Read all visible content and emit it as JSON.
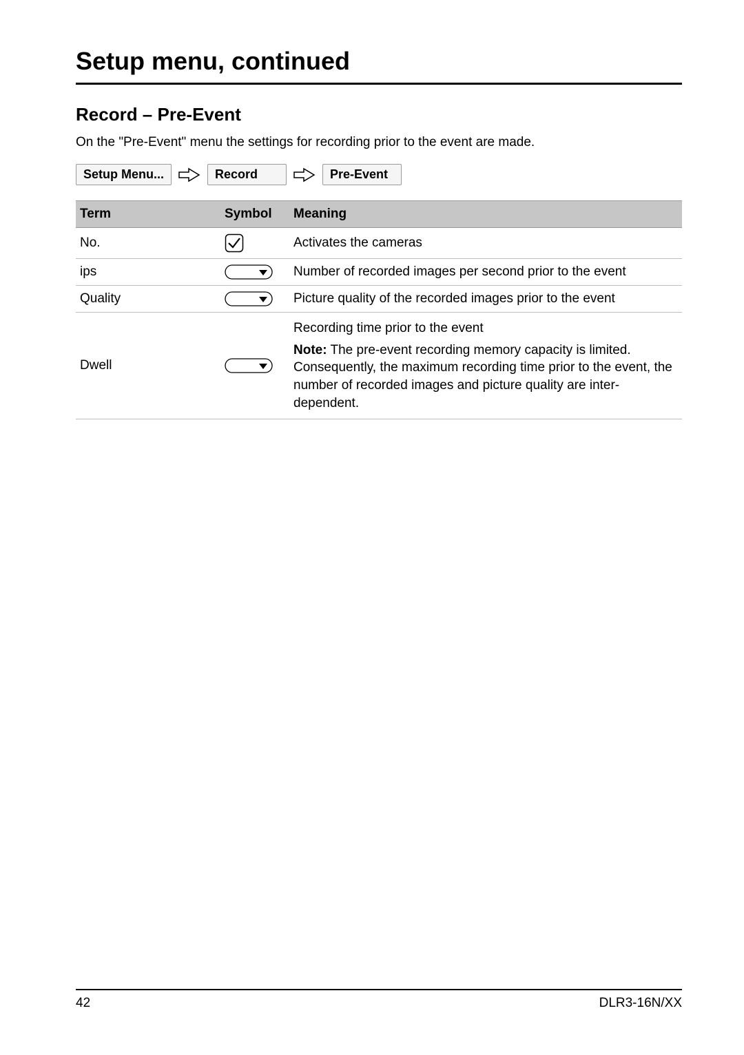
{
  "title": "Setup menu, continued",
  "section": "Record – Pre-Event",
  "intro": "On the \"Pre-Event\" menu the settings for recording prior to the event are made.",
  "breadcrumb": [
    "Setup Menu...",
    "Record",
    "Pre-Event"
  ],
  "table": {
    "headers": {
      "term": "Term",
      "symbol": "Symbol",
      "meaning": "Meaning"
    },
    "rows": [
      {
        "term": "No.",
        "symbol": "checkbox",
        "meaning": "Activates the cameras"
      },
      {
        "term": "ips",
        "symbol": "dropdown",
        "meaning": "Number of recorded images per second prior to the event"
      },
      {
        "term": "Quality",
        "symbol": "dropdown",
        "meaning": "Picture quality of the recorded images prior to the event"
      },
      {
        "term": "Dwell",
        "symbol": "dropdown",
        "meaning_primary": "Recording time prior to the event",
        "note_label": "Note:",
        "note_body": " The pre-event recording memory capacity is limited. Consequently, the maximum recording time prior to the event, the number of recorded images and picture quality are inter-dependent."
      }
    ]
  },
  "footer": {
    "page_number": "42",
    "model": "DLR3-16N/XX"
  }
}
